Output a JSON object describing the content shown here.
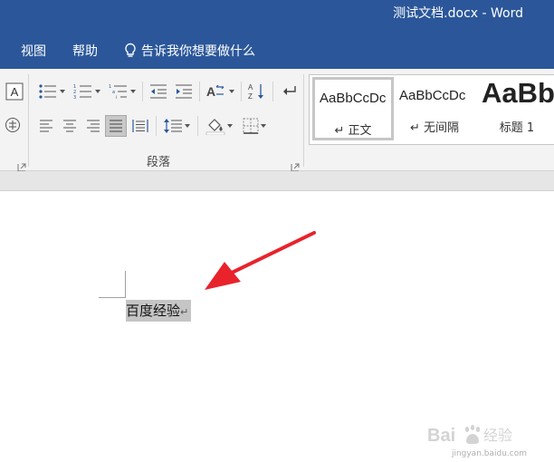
{
  "window": {
    "title": "测试文档.docx  -  Word"
  },
  "menu": {
    "view": "视图",
    "help": "帮助",
    "tell_me": "告诉我你想要做什么"
  },
  "ribbon": {
    "paragraph_group_label": "段落",
    "styles": [
      {
        "sample": "AaBbCcDc",
        "name": "正文",
        "selected": true
      },
      {
        "sample": "AaBbCcDc",
        "name": "无间隔",
        "selected": false
      },
      {
        "sample": "AaBb",
        "name": "标题 1",
        "selected": false
      }
    ]
  },
  "document": {
    "text": "百度经验",
    "paragraph_mark": "↵"
  },
  "watermark": {
    "brand": "Bai",
    "brand_suffix": "经验",
    "url": "jingyan.baidu.com"
  },
  "colors": {
    "title_bar": "#2b579a",
    "ribbon_bg": "#f3f3f3",
    "arrow": "#e8232c",
    "selection": "#c5c5c5"
  }
}
